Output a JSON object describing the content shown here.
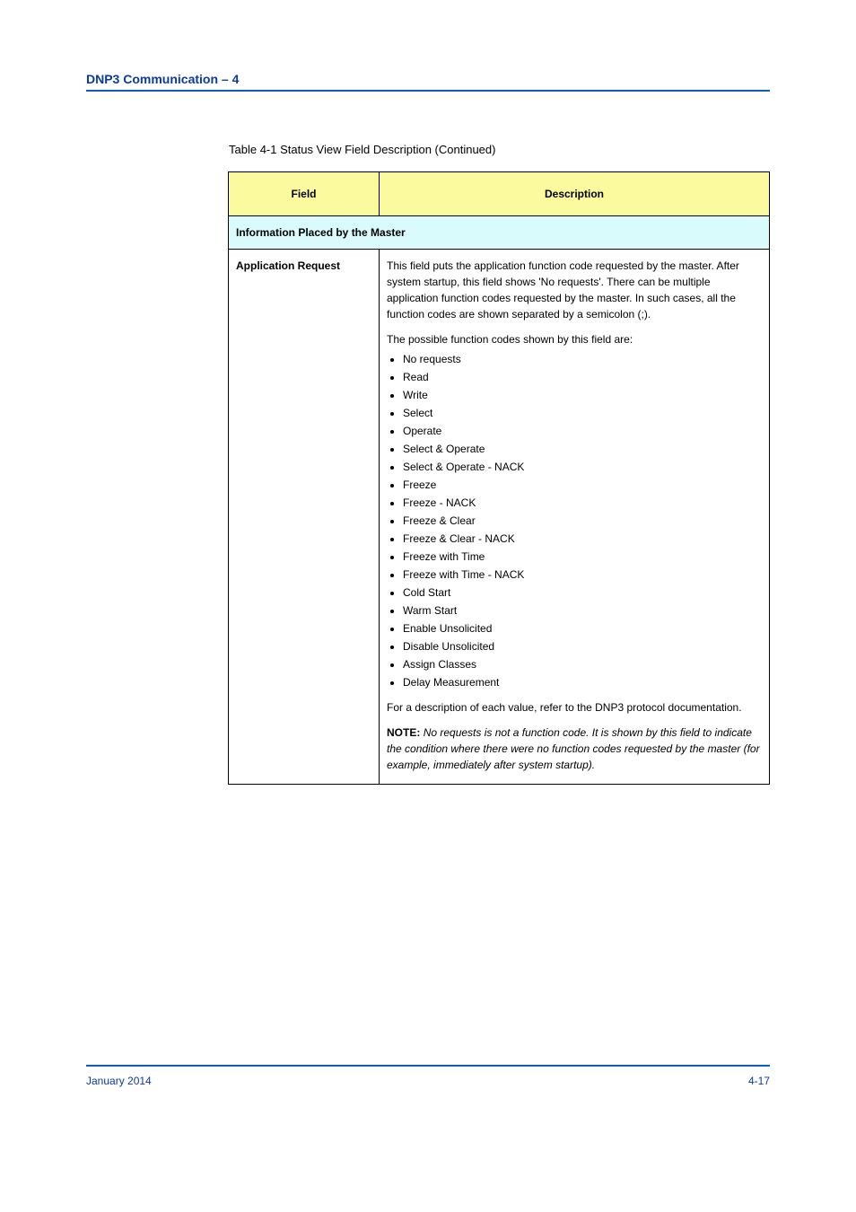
{
  "header": {
    "title": "DNP3 Communication – 4"
  },
  "table": {
    "caption": "Table 4-1 Status View Field Description (Continued)",
    "columns": {
      "field": "Field",
      "description": "Description"
    },
    "section": "Information Placed by the Master",
    "row": {
      "field": "Application Request",
      "desc": {
        "p1": "This field puts the application function code requested by the master. After system startup, this field shows 'No requests'. There can be multiple application function codes requested by the master. In such cases, all the function codes are shown separated by a semicolon (;).",
        "p2": "The possible function codes shown by this field are:",
        "li1": "No requests",
        "li2": "Read",
        "li3": "Write",
        "li4": "Select",
        "li5": "Operate",
        "li6": "Select & Operate",
        "li7": "Select & Operate - NACK",
        "li8": "Freeze",
        "li9": "Freeze - NACK",
        "li10": "Freeze & Clear",
        "li11": "Freeze & Clear - NACK",
        "li12": "Freeze with Time",
        "li13": "Freeze with Time - NACK",
        "li14": "Cold Start",
        "li15": "Warm Start",
        "li16": "Enable Unsolicited",
        "li17": "Disable Unsolicited",
        "li18": "Assign Classes",
        "li19": "Delay Measurement",
        "p3": "For a description of each value, refer to the DNP3 protocol documentation.",
        "note_label": "NOTE:",
        "note_body": "No requests is not a function code. It is shown by this field to indicate the condition where there were no function codes requested by the master (for example, immediately after system startup)."
      }
    }
  },
  "footer": {
    "left": "January 2014",
    "right": "4-17"
  }
}
